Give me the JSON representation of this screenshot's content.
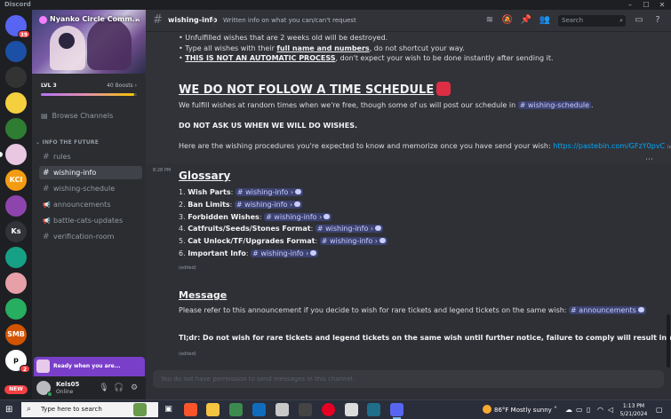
{
  "window": {
    "app_name": "Discord"
  },
  "servers": [
    {
      "name": "home",
      "badge": "39",
      "color": "#5865f2"
    },
    {
      "name": "server-2",
      "color": "#1c4fa6"
    },
    {
      "name": "server-3",
      "color": "#333333"
    },
    {
      "name": "server-4",
      "color": "#f4d03f"
    },
    {
      "name": "server-5",
      "color": "#2e7d32"
    },
    {
      "name": "nyanko-circle",
      "color": "#e9c7e3",
      "active": true
    },
    {
      "name": "server-7",
      "color": "#f39c12",
      "label": "KCI"
    },
    {
      "name": "server-8",
      "color": "#8e44ad"
    },
    {
      "name": "Ks",
      "label": "Ks",
      "color": "#313338"
    },
    {
      "name": "server-10",
      "color": "#16a085"
    },
    {
      "name": "server-11",
      "color": "#e8a0a8"
    },
    {
      "name": "server-12",
      "color": "#27ae60"
    },
    {
      "name": "server-13",
      "color": "#d35400",
      "label": "SMB"
    },
    {
      "name": "server-14",
      "color": "#ffffff",
      "label": "p",
      "badge": "2"
    }
  ],
  "new_badge": "NEW",
  "sidebar": {
    "server_name": "Nyanko Circle Comm...",
    "level": "LVL 3",
    "boosts": "40 Boosts",
    "boost_progress": 0.97,
    "browse": "Browse Channels",
    "category": "INFO THE FUTURE",
    "channels": [
      {
        "name": "rules",
        "icon": "hash"
      },
      {
        "name": "wishing-info",
        "icon": "hash",
        "active": true
      },
      {
        "name": "wishing-schedule",
        "icon": "hash"
      },
      {
        "name": "announcements",
        "icon": "megaphone"
      },
      {
        "name": "battle-cats-updates",
        "icon": "megaphone"
      },
      {
        "name": "verification-room",
        "icon": "hash"
      }
    ]
  },
  "ready_banner": "Ready when you are...",
  "user": {
    "name": "Kels05",
    "status": "Online"
  },
  "header": {
    "channel": "wishing-info",
    "topic": "Written info on what you can/can't request",
    "search_placeholder": "Search"
  },
  "messages": {
    "line1": "• Unfulfilled wishes that are 2 weeks old will be destroyed.",
    "line2_pre": "• Type all wishes with their ",
    "line2_bold": "full name and numbers",
    "line2_post": ", do not shortcut your way.",
    "line3_bold": "THIS IS NOT AN AUTOMATIC PROCESS",
    "line3_post": ", don't expect your wish to be done instantly after sending it.",
    "heading1": "WE DO NOT FOLLOW A TIME SCHEDULE",
    "para1_pre": "We fulfill wishes at random times when we're free, though some of us will post our schedule in ",
    "para1_mention": "# wishing-schedule",
    "para1_post": ".",
    "bold1": "DO NOT ASK US WHEN WE WILL DO WISHES.",
    "para2_pre": "Here are the wishing procedures you're expected to know and memorize once you have send your wish: ",
    "para2_link": "https://pastebin.com/GFzY0pvC",
    "edited": "(edited)",
    "timestamp": "8:28 PM",
    "heading2": "Glossary",
    "glossary": [
      {
        "num": "1.",
        "label": "Wish Parts",
        "mention": "# wishing-info"
      },
      {
        "num": "2.",
        "label": "Ban Limits",
        "mention": "# wishing-info"
      },
      {
        "num": "3.",
        "label": "Forbidden Wishes",
        "mention": "# wishing-info"
      },
      {
        "num": "4.",
        "label": "Catfruits/Seeds/Stones Format",
        "mention": "# wishing-info"
      },
      {
        "num": "5.",
        "label": "Cat Unlock/TF/Upgrades Format",
        "mention": "# wishing-info"
      },
      {
        "num": "6.",
        "label": "Important Info",
        "mention": "# wishing-info"
      }
    ],
    "heading3": "Message",
    "para3_pre": "Please refer to this announcement if you decide to wish for rare tickets and legend tickets on the same wish: ",
    "para3_mention": "# announcements",
    "tldr": "Tl;dr: Do not wish for rare tickets and legend tickets on the same wish until further notice, failure to comply will result in warn points."
  },
  "composer_placeholder": "You do not have permission to send messages in this channel.",
  "taskbar": {
    "search_placeholder": "Type here to search",
    "temperature": "86°F",
    "weather": "Mostly sunny",
    "time": "1:13 PM",
    "date": "5/21/2024"
  }
}
